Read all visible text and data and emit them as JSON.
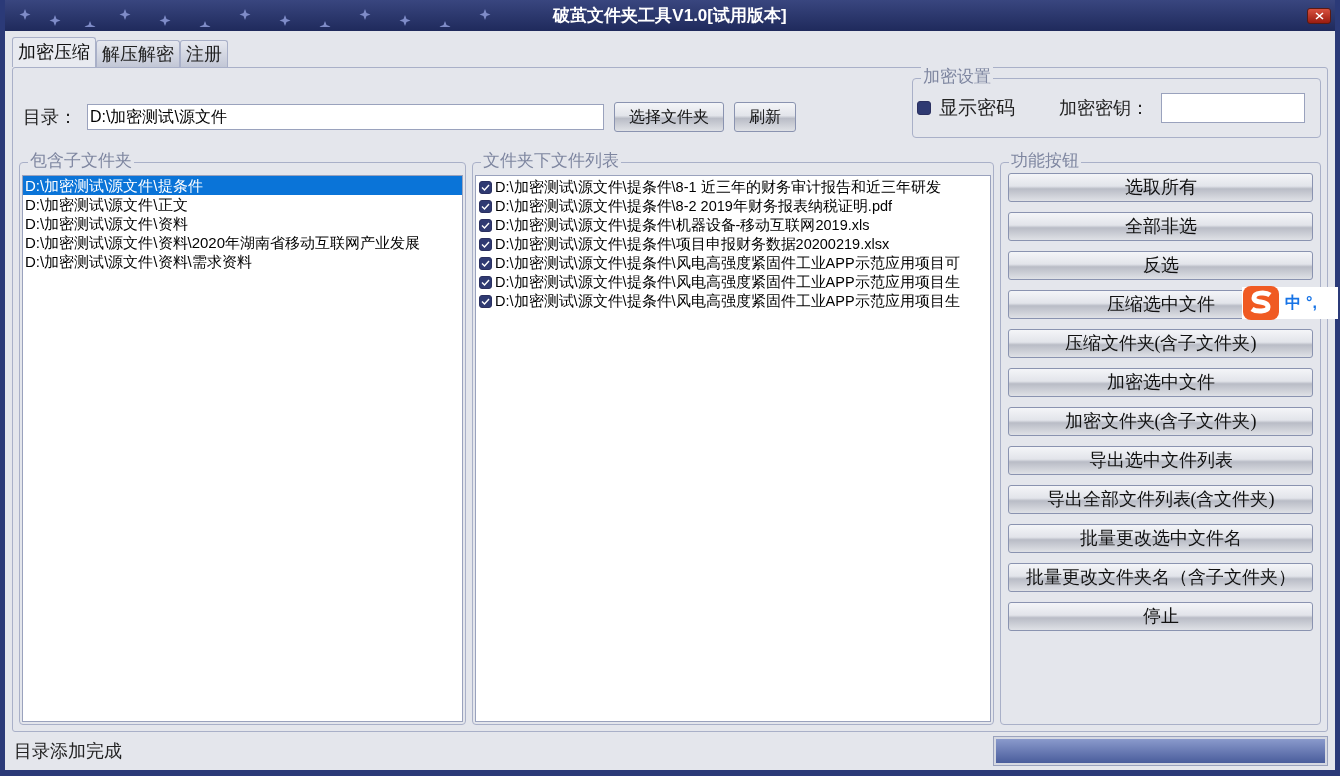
{
  "window": {
    "title": "破茧文件夹工具V1.0[试用版本]"
  },
  "tabs": [
    {
      "label": "加密压缩",
      "selected": true
    },
    {
      "label": "解压解密",
      "selected": false
    },
    {
      "label": "注册",
      "selected": false
    }
  ],
  "directory": {
    "label": "目录：",
    "value": "D:\\加密测试\\源文件",
    "buttons": [
      "选择文件夹",
      "刷新"
    ]
  },
  "encryption_settings": {
    "title": "加密设置",
    "show_password": {
      "label": "显示密码",
      "checked": true
    },
    "key_label": "加密密钥："
  },
  "subfolders": {
    "title": "包含子文件夹",
    "items": [
      {
        "text": "D:\\加密测试\\源文件\\提条件",
        "selected": true
      },
      {
        "text": "D:\\加密测试\\源文件\\正文",
        "selected": false
      },
      {
        "text": "D:\\加密测试\\源文件\\资料",
        "selected": false
      },
      {
        "text": "D:\\加密测试\\源文件\\资料\\2020年湖南省移动互联网产业发展",
        "selected": false
      },
      {
        "text": "D:\\加密测试\\源文件\\资料\\需求资料",
        "selected": false
      }
    ]
  },
  "files": {
    "title": "文件夹下文件列表",
    "items": [
      {
        "text": "D:\\加密测试\\源文件\\提条件\\8-1 近三年的财务审计报告和近三年研发",
        "checked": true
      },
      {
        "text": "D:\\加密测试\\源文件\\提条件\\8-2 2019年财务报表纳税证明.pdf",
        "checked": true
      },
      {
        "text": "D:\\加密测试\\源文件\\提条件\\机器设备-移动互联网2019.xls",
        "checked": true
      },
      {
        "text": "D:\\加密测试\\源文件\\提条件\\项目申报财务数据20200219.xlsx",
        "checked": true
      },
      {
        "text": "D:\\加密测试\\源文件\\提条件\\风电高强度紧固件工业APP示范应用项目可",
        "checked": true
      },
      {
        "text": "D:\\加密测试\\源文件\\提条件\\风电高强度紧固件工业APP示范应用项目生",
        "checked": true
      },
      {
        "text": "D:\\加密测试\\源文件\\提条件\\风电高强度紧固件工业APP示范应用项目生",
        "checked": true
      }
    ]
  },
  "functions": {
    "title": "功能按钮",
    "buttons": [
      "选取所有",
      "全部非选",
      "反选",
      "压缩选中文件",
      "压缩文件夹(含子文件夹)",
      "加密选中文件",
      "加密文件夹(含子文件夹)",
      "导出选中文件列表",
      "导出全部文件列表(含文件夹)",
      "批量更改选中文件名",
      "批量更改文件夹名（含子文件夹）",
      "停止"
    ]
  },
  "ime_toolbar": {
    "texts": [
      "中",
      "°,"
    ]
  },
  "status_bar": {
    "text": "目录添加完成",
    "progress": {
      "level": 1
    }
  }
}
